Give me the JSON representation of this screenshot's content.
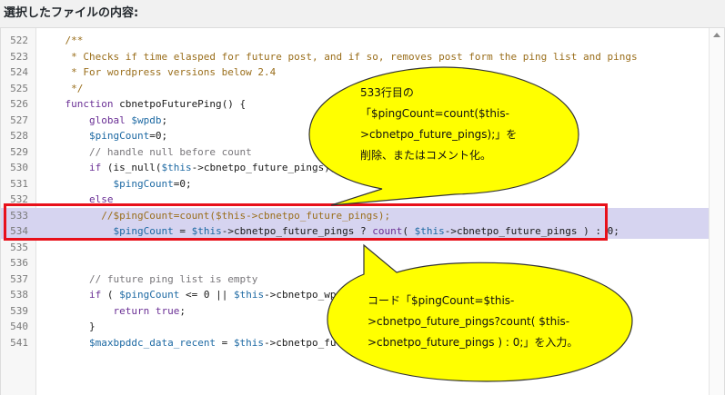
{
  "file_heading": "選択したファイルの内容:",
  "lines": [
    {
      "n": "522",
      "parts": [
        {
          "t": "    /**",
          "c": "cmt"
        }
      ]
    },
    {
      "n": "523",
      "parts": [
        {
          "t": "     * Checks if time elasped for future post, and if so, removes post form the ping list and pings",
          "c": "cmt"
        }
      ]
    },
    {
      "n": "524",
      "parts": [
        {
          "t": "     * For wordpress versions below 2.4",
          "c": "cmt"
        }
      ]
    },
    {
      "n": "525",
      "parts": [
        {
          "t": "     */",
          "c": "cmt"
        }
      ]
    },
    {
      "n": "526",
      "parts": [
        {
          "t": "    function ",
          "c": "kw"
        },
        {
          "t": "cbnetpoFuturePing",
          "c": "plain"
        },
        {
          "t": "() {",
          "c": "plain"
        }
      ]
    },
    {
      "n": "527",
      "parts": [
        {
          "t": "        global ",
          "c": "kw"
        },
        {
          "t": "$wpdb",
          "c": "var"
        },
        {
          "t": ";",
          "c": "plain"
        }
      ]
    },
    {
      "n": "528",
      "parts": [
        {
          "t": "        ",
          "c": "plain"
        },
        {
          "t": "$pingCount",
          "c": "var"
        },
        {
          "t": "=0;",
          "c": "plain"
        }
      ]
    },
    {
      "n": "529",
      "parts": [
        {
          "t": "        // handle null before count",
          "c": "cm2"
        }
      ]
    },
    {
      "n": "530",
      "parts": [
        {
          "t": "        if ",
          "c": "kw"
        },
        {
          "t": "(is_null(",
          "c": "plain"
        },
        {
          "t": "$this",
          "c": "var"
        },
        {
          "t": "->cbnetpo_future_pings))",
          "c": "plain"
        }
      ]
    },
    {
      "n": "531",
      "parts": [
        {
          "t": "            ",
          "c": "plain"
        },
        {
          "t": "$pingCount",
          "c": "var"
        },
        {
          "t": "=0;",
          "c": "plain"
        }
      ]
    },
    {
      "n": "532",
      "parts": [
        {
          "t": "        else",
          "c": "kw"
        }
      ]
    },
    {
      "n": "533",
      "sel": true,
      "parts": [
        {
          "t": "          //$pingCount=count($this->cbnetpo_future_pings);",
          "c": "cmt"
        }
      ]
    },
    {
      "n": "534",
      "sel": true,
      "parts": [
        {
          "t": "            ",
          "c": "plain"
        },
        {
          "t": "$pingCount",
          "c": "var"
        },
        {
          "t": " = ",
          "c": "plain"
        },
        {
          "t": "$this",
          "c": "var"
        },
        {
          "t": "->cbnetpo_future_pings ? ",
          "c": "plain"
        },
        {
          "t": "count",
          "c": "kw"
        },
        {
          "t": "( ",
          "c": "plain"
        },
        {
          "t": "$this",
          "c": "var"
        },
        {
          "t": "->cbnetpo_future_pings ) : 0;",
          "c": "plain"
        }
      ]
    },
    {
      "n": "535",
      "parts": []
    },
    {
      "n": "536",
      "parts": []
    },
    {
      "n": "537",
      "parts": [
        {
          "t": "        // future ping list is empty",
          "c": "cm2"
        }
      ]
    },
    {
      "n": "538",
      "parts": [
        {
          "t": "        if ",
          "c": "kw"
        },
        {
          "t": "( ",
          "c": "plain"
        },
        {
          "t": "$pingCount",
          "c": "var"
        },
        {
          "t": " <= 0 || ",
          "c": "plain"
        },
        {
          "t": "$this",
          "c": "var"
        },
        {
          "t": "->cbnetpo_wp_v",
          "c": "plain"
        }
      ]
    },
    {
      "n": "539",
      "parts": [
        {
          "t": "            return true",
          "c": "kw"
        },
        {
          "t": ";",
          "c": "plain"
        }
      ]
    },
    {
      "n": "540",
      "parts": [
        {
          "t": "        }",
          "c": "plain"
        }
      ]
    },
    {
      "n": "541",
      "parts": [
        {
          "t": "        ",
          "c": "plain"
        },
        {
          "t": "$maxbpddc_data_recent",
          "c": "var"
        },
        {
          "t": " = ",
          "c": "plain"
        },
        {
          "t": "$this",
          "c": "var"
        },
        {
          "t": "->cbnetpo_futu",
          "c": "plain"
        }
      ]
    }
  ],
  "callout_top": {
    "line1": "533行目の",
    "line2": "「$pingCount=count($this-",
    "line3": ">cbnetpo_future_pings);」を",
    "line4": "削除、またはコメント化。"
  },
  "callout_bottom": {
    "line1": "コード「$pingCount=$this-",
    "line2": ">cbnetpo_future_pings?count( $this-",
    "line3": ">cbnetpo_future_pings ) : 0;」を入力。"
  },
  "colors": {
    "highlight_box": "#e8101a",
    "callout_fill": "#ffff00",
    "selection": "#d6d4f0"
  }
}
